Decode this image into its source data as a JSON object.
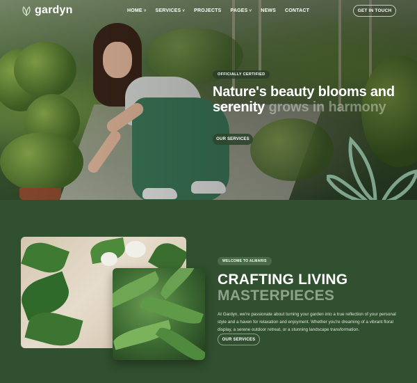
{
  "brand": {
    "name": "gardyn",
    "logo_icon": "leaf-logo-icon"
  },
  "nav": {
    "items": [
      {
        "label": "HOME",
        "has_dropdown": true
      },
      {
        "label": "SERVICES",
        "has_dropdown": true
      },
      {
        "label": "PROJECTS",
        "has_dropdown": false
      },
      {
        "label": "PAGES",
        "has_dropdown": true
      },
      {
        "label": "NEWS",
        "has_dropdown": false
      },
      {
        "label": "CONTACT",
        "has_dropdown": false
      }
    ],
    "cta": "GET IN TOUCH",
    "chevron": "˅"
  },
  "hero": {
    "badge": "OFFICIALLY CERTIFIED",
    "title_strong": "Nature's beauty blooms and serenity",
    "title_muted": "grows in harmony",
    "button": "OUR SERVICES"
  },
  "about": {
    "badge": "WELCOME TO ALMARIS",
    "title_strong": "CRAFTING LIVING",
    "title_muted": "MASTERPIECES",
    "body": "At Gardyn, we're passionate about turning your garden into a true reflection of your personal style and a haven for relaxation and enjoyment. Whether you're dreaming of a vibrant floral display, a serene outdoor retreat, or a stunning landscape transformation.",
    "button": "OUR SERVICES"
  },
  "colors": {
    "background": "#31502f",
    "accent_muted": "#8ea38b",
    "badge": "#4a6b48"
  }
}
